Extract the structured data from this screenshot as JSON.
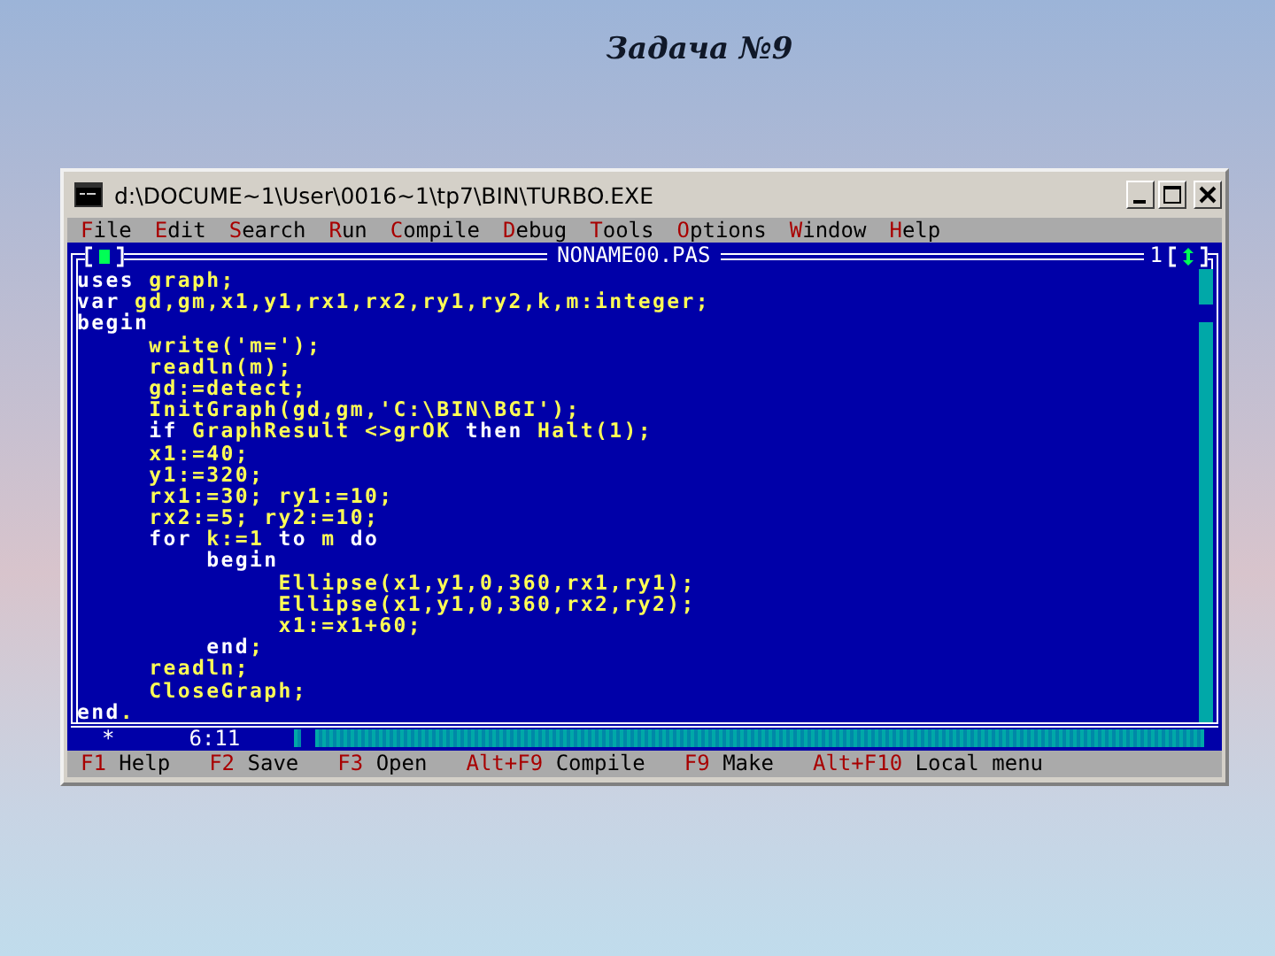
{
  "slide": {
    "title": "Задача №9"
  },
  "window": {
    "title": "d:\\DOCUME~1\\User\\0016~1\\tp7\\BIN\\TURBO.EXE"
  },
  "menu": [
    "File",
    "Edit",
    "Search",
    "Run",
    "Compile",
    "Debug",
    "Tools",
    "Options",
    "Window",
    "Help"
  ],
  "editor": {
    "file_name": "NONAME00.PAS",
    "window_number": "1",
    "modified_mark": "*",
    "cursor_position": "6:11",
    "lines": [
      {
        "segments": [
          {
            "kind": "keyword",
            "text": "uses"
          },
          {
            "kind": "code",
            "text": " graph;"
          }
        ]
      },
      {
        "segments": [
          {
            "kind": "keyword",
            "text": "var"
          },
          {
            "kind": "code",
            "text": " gd,gm,x1,y1,rx1,rx2,ry1,ry2,k,m:integer;"
          }
        ]
      },
      {
        "segments": [
          {
            "kind": "keyword",
            "text": "begin"
          }
        ]
      },
      {
        "segments": [
          {
            "kind": "code",
            "text": "     write('m=');"
          }
        ]
      },
      {
        "segments": [
          {
            "kind": "code",
            "text": "     readln(m);"
          }
        ]
      },
      {
        "segments": [
          {
            "kind": "code",
            "text": "     gd:=detect;"
          }
        ]
      },
      {
        "segments": [
          {
            "kind": "code",
            "text": "     InitGraph(gd,gm,'C:\\BIN\\BGI');"
          }
        ]
      },
      {
        "segments": [
          {
            "kind": "keyword",
            "text": "     if"
          },
          {
            "kind": "code",
            "text": " GraphResult <>grOK "
          },
          {
            "kind": "keyword",
            "text": "then"
          },
          {
            "kind": "code",
            "text": " Halt(1);"
          }
        ]
      },
      {
        "segments": [
          {
            "kind": "code",
            "text": "     x1:=40;"
          }
        ]
      },
      {
        "segments": [
          {
            "kind": "code",
            "text": "     y1:=320;"
          }
        ]
      },
      {
        "segments": [
          {
            "kind": "code",
            "text": "     rx1:=30; ry1:=10;"
          }
        ]
      },
      {
        "segments": [
          {
            "kind": "code",
            "text": "     rx2:=5; ry2:=10;"
          }
        ]
      },
      {
        "segments": [
          {
            "kind": "keyword",
            "text": "     for"
          },
          {
            "kind": "code",
            "text": " k:=1 "
          },
          {
            "kind": "keyword",
            "text": "to"
          },
          {
            "kind": "code",
            "text": " m "
          },
          {
            "kind": "keyword",
            "text": "do"
          }
        ]
      },
      {
        "segments": [
          {
            "kind": "keyword",
            "text": "         begin"
          }
        ]
      },
      {
        "segments": [
          {
            "kind": "code",
            "text": "              Ellipse(x1,y1,0,360,rx1,ry1);"
          }
        ]
      },
      {
        "segments": [
          {
            "kind": "code",
            "text": "              Ellipse(x1,y1,0,360,rx2,ry2);"
          }
        ]
      },
      {
        "segments": [
          {
            "kind": "code",
            "text": "              x1:=x1+60;"
          }
        ]
      },
      {
        "segments": [
          {
            "kind": "keyword",
            "text": "         end"
          },
          {
            "kind": "code",
            "text": ";"
          }
        ]
      },
      {
        "segments": [
          {
            "kind": "code",
            "text": "     readln;"
          }
        ]
      },
      {
        "segments": [
          {
            "kind": "code",
            "text": "     CloseGraph;"
          }
        ]
      },
      {
        "segments": [
          {
            "kind": "keyword",
            "text": "end"
          },
          {
            "kind": "code",
            "text": "."
          }
        ]
      }
    ]
  },
  "status_bar": [
    {
      "key": "F1",
      "label": "Help"
    },
    {
      "key": "F2",
      "label": "Save"
    },
    {
      "key": "F3",
      "label": "Open"
    },
    {
      "key": "Alt+F9",
      "label": "Compile"
    },
    {
      "key": "F9",
      "label": "Make"
    },
    {
      "key": "Alt+F10",
      "label": "Local menu"
    }
  ]
}
